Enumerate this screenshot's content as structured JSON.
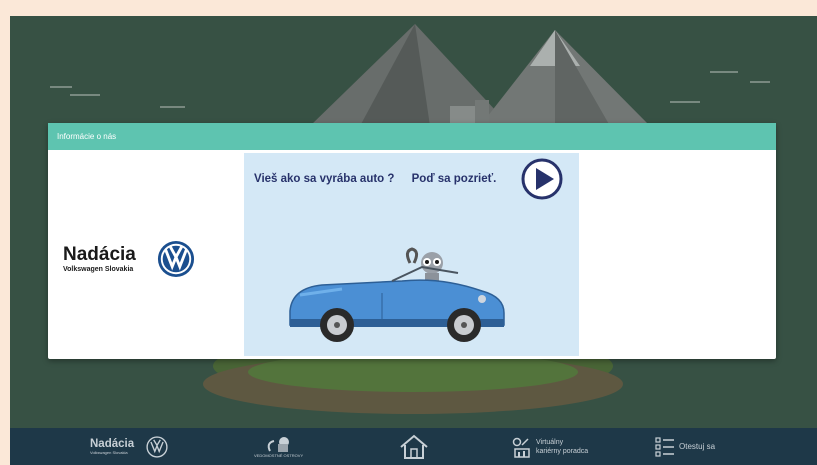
{
  "modal": {
    "title": "Informácie o nás"
  },
  "brand": {
    "name": "Nadácia",
    "subtitle": "Volkswagen Slovakia"
  },
  "video": {
    "question": "Vieš ako sa vyrába auto ?",
    "cta": "Poď sa pozrieť."
  },
  "bottom_nav": {
    "brand_name": "Nadácia",
    "brand_subtitle": "Volkswagen Slovakia",
    "islands_label": "VEDOMOSTNÉ OSTROVY",
    "advisor_line1": "Virtuálny",
    "advisor_line2": "kariérny poradca",
    "test_label": "Otestuj sa"
  },
  "colors": {
    "header_accent": "#5ec4b0",
    "nav_bg": "#1e3848",
    "title_text": "#27326b",
    "video_bg": "#d4e8f6"
  },
  "icons": [
    "vw-logo-icon",
    "play-icon",
    "lemur-icon",
    "home-icon",
    "career-advisor-icon",
    "checklist-icon"
  ]
}
